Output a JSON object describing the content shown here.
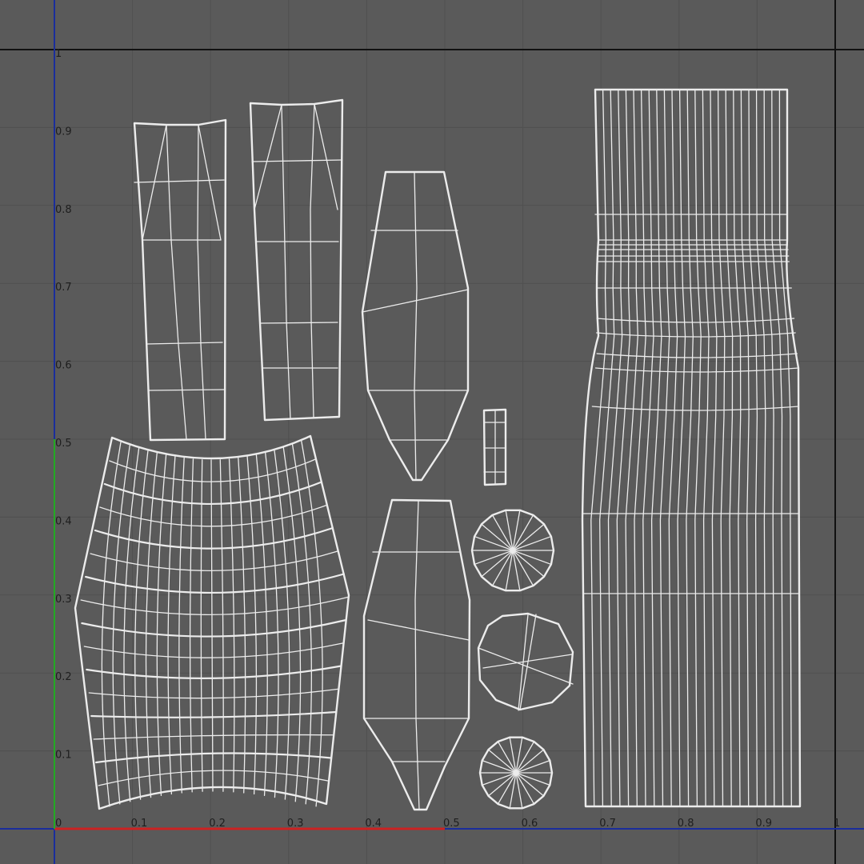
{
  "editor": {
    "view": "UV Texture Editor",
    "grid": true,
    "colors": {
      "background": "#5a5a5a",
      "grid": "#505050",
      "wireframe": "#ececec",
      "frame_border": "#111111",
      "u_axis": "#cc2222",
      "v_axis": "#22aa22",
      "border_axis": "#1a2d9c"
    }
  },
  "axes": {
    "u_ticks": [
      "0",
      "0.1",
      "0.2",
      "0.3",
      "0.4",
      "0.5",
      "0.6",
      "0.7",
      "0.8",
      "0.9",
      "1"
    ],
    "v_ticks": [
      "0.1",
      "0.2",
      "0.3",
      "0.4",
      "0.5",
      "0.6",
      "0.7",
      "0.8",
      "0.9",
      "1"
    ]
  },
  "uv_shells": [
    {
      "id": "sleeve-left",
      "uv_bounds": [
        0.1,
        0.49,
        0.22,
        0.9
      ]
    },
    {
      "id": "sleeve-right",
      "uv_bounds": [
        0.25,
        0.51,
        0.37,
        0.93
      ]
    },
    {
      "id": "top-panel",
      "uv_bounds": [
        0.02,
        0.02,
        0.38,
        0.49
      ]
    },
    {
      "id": "cup-upper",
      "uv_bounds": [
        0.39,
        0.44,
        0.53,
        0.84
      ]
    },
    {
      "id": "cup-lower",
      "uv_bounds": [
        0.39,
        0.02,
        0.53,
        0.42
      ]
    },
    {
      "id": "strap",
      "uv_bounds": [
        0.55,
        0.44,
        0.58,
        0.53
      ]
    },
    {
      "id": "cap-top",
      "uv_bounds": [
        0.54,
        0.3,
        0.64,
        0.4
      ]
    },
    {
      "id": "cap-middle",
      "uv_bounds": [
        0.55,
        0.15,
        0.67,
        0.27
      ]
    },
    {
      "id": "cap-bottom",
      "uv_bounds": [
        0.55,
        0.04,
        0.64,
        0.13
      ]
    },
    {
      "id": "body-tube",
      "uv_bounds": [
        0.67,
        0.02,
        0.95,
        0.94
      ]
    }
  ]
}
